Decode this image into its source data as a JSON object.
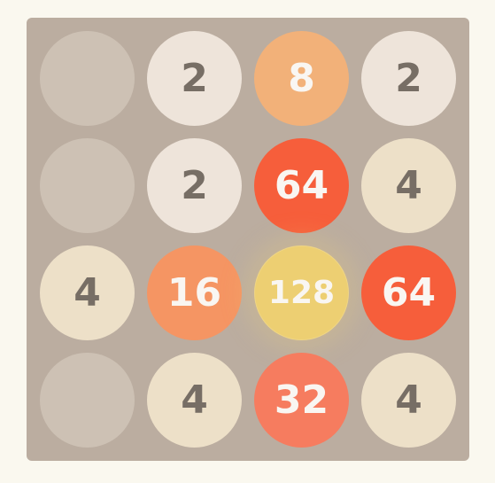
{
  "board": {
    "rows": [
      [
        "",
        "2",
        "8",
        "2"
      ],
      [
        "",
        "2",
        "64",
        "4"
      ],
      [
        "4",
        "16",
        "128",
        "64"
      ],
      [
        "",
        "4",
        "32",
        "4"
      ]
    ]
  },
  "colors": {
    "background": "#faf8ef",
    "board": "#bbada0",
    "empty": "#cdc1b4",
    "tile_2": "#eee4da",
    "tile_4": "#ede0c8",
    "tile_8": "#f2b179",
    "tile_16": "#f59563",
    "tile_32": "#f67c5f",
    "tile_64": "#f65e3b",
    "tile_128": "#edcf72",
    "dark_text": "#776e65",
    "light_text": "#f9f6f2"
  }
}
